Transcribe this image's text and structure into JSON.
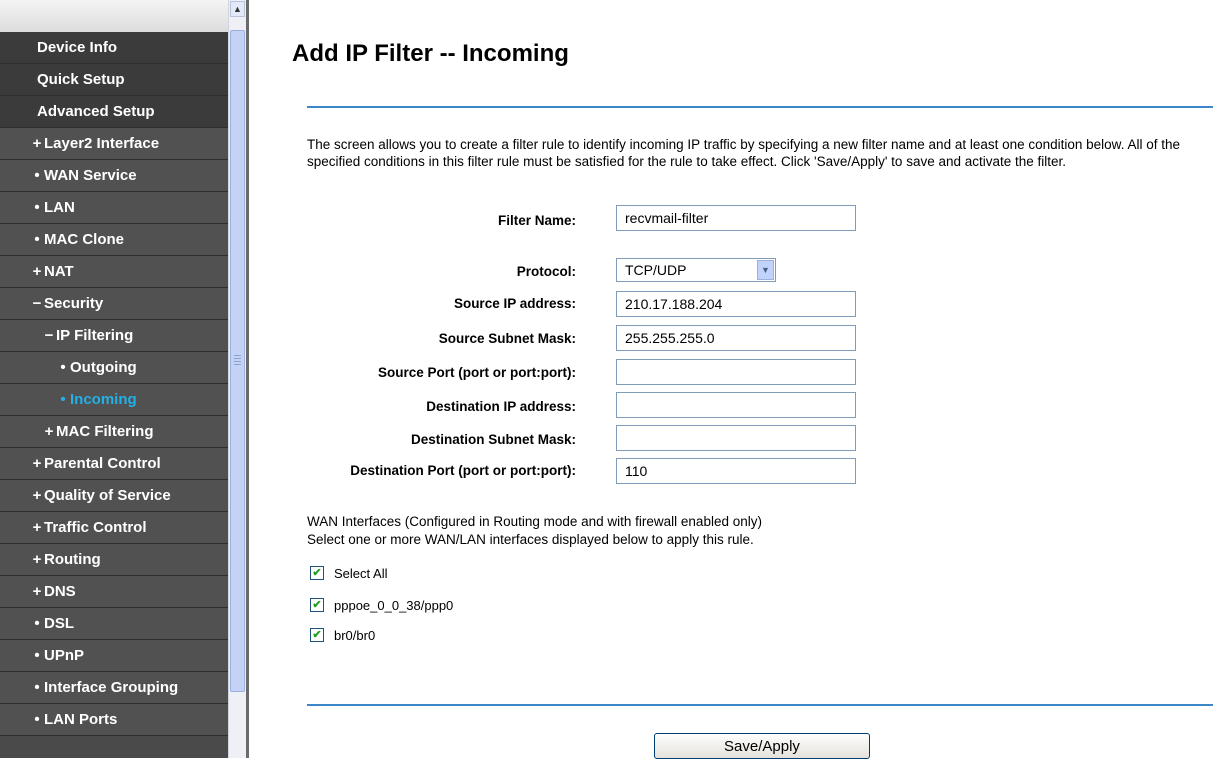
{
  "sidebar": {
    "items": [
      {
        "label": "Device Info",
        "marker": ""
      },
      {
        "label": "Quick Setup",
        "marker": ""
      },
      {
        "label": "Advanced Setup",
        "marker": ""
      },
      {
        "label": "Layer2 Interface",
        "marker": "+"
      },
      {
        "label": "WAN Service",
        "marker": "•"
      },
      {
        "label": "LAN",
        "marker": "•"
      },
      {
        "label": "MAC Clone",
        "marker": "•"
      },
      {
        "label": "NAT",
        "marker": "+"
      },
      {
        "label": "Security",
        "marker": "−"
      },
      {
        "label": "IP Filtering",
        "marker": "−"
      },
      {
        "label": "Outgoing",
        "marker": "•"
      },
      {
        "label": "Incoming",
        "marker": "•"
      },
      {
        "label": "MAC Filtering",
        "marker": "+"
      },
      {
        "label": "Parental Control",
        "marker": "+"
      },
      {
        "label": "Quality of Service",
        "marker": "+"
      },
      {
        "label": "Traffic Control",
        "marker": "+"
      },
      {
        "label": "Routing",
        "marker": "+"
      },
      {
        "label": "DNS",
        "marker": "+"
      },
      {
        "label": "DSL",
        "marker": "•"
      },
      {
        "label": "UPnP",
        "marker": "•"
      },
      {
        "label": "Interface Grouping",
        "marker": "•"
      },
      {
        "label": "LAN Ports",
        "marker": "•"
      }
    ],
    "active_item": "Incoming",
    "active_color": "#22b0e6"
  },
  "main": {
    "title": "Add IP Filter -- Incoming",
    "description": "The screen allows you to create a filter rule to identify incoming IP traffic by specifying a new filter name and at least one condition below. All of the specified conditions in this filter rule must be satisfied for the rule to take effect. Click 'Save/Apply' to save and activate the filter.",
    "form": {
      "filter_name": {
        "label": "Filter Name:",
        "value": "recvmail-filter"
      },
      "protocol": {
        "label": "Protocol:",
        "value": "TCP/UDP"
      },
      "source_ip": {
        "label": "Source IP address:",
        "value": "210.17.188.204"
      },
      "source_mask": {
        "label": "Source Subnet Mask:",
        "value": "255.255.255.0"
      },
      "source_port": {
        "label": "Source Port (port or port:port):",
        "value": ""
      },
      "dest_ip": {
        "label": "Destination IP address:",
        "value": ""
      },
      "dest_mask": {
        "label": "Destination Subnet Mask:",
        "value": ""
      },
      "dest_port": {
        "label": "Destination Port (port or port:port):",
        "value": "110"
      }
    },
    "wan": {
      "title": "WAN Interfaces (Configured in Routing mode and with firewall enabled only)",
      "note": "Select one or more WAN/LAN interfaces displayed below to apply this rule.",
      "options": [
        {
          "label": "Select All",
          "checked": true
        },
        {
          "label": "pppoe_0_0_38/ppp0",
          "checked": true
        },
        {
          "label": "br0/br0",
          "checked": true
        }
      ]
    },
    "save_label": "Save/Apply",
    "accent_color": "#3c87c8"
  }
}
